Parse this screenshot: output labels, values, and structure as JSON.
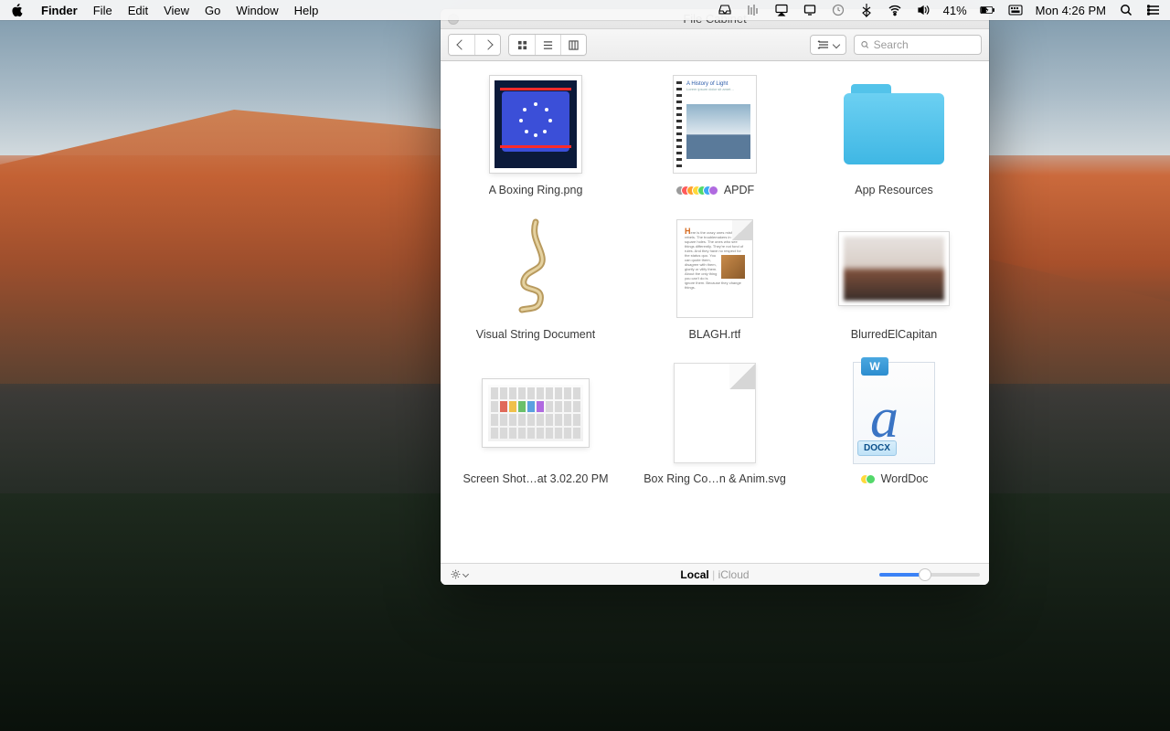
{
  "menubar": {
    "app": "Finder",
    "items": [
      "File",
      "Edit",
      "View",
      "Go",
      "Window",
      "Help"
    ],
    "battery_pct": "41%",
    "clock": "Mon 4:26 PM"
  },
  "window": {
    "title": "File Cabinet",
    "search_placeholder": "Search",
    "status": {
      "local": "Local",
      "icloud": "iCloud"
    }
  },
  "files": [
    {
      "name": "A Boxing Ring.png"
    },
    {
      "name": "APDF"
    },
    {
      "name": "App Resources"
    },
    {
      "name": "Visual String Document"
    },
    {
      "name": "BLAGH.rtf"
    },
    {
      "name": "BlurredElCapitan"
    },
    {
      "name": "Screen Shot…at 3.02.20 PM"
    },
    {
      "name": "Box Ring Co…n & Anim.svg"
    },
    {
      "name": "WordDoc"
    }
  ]
}
